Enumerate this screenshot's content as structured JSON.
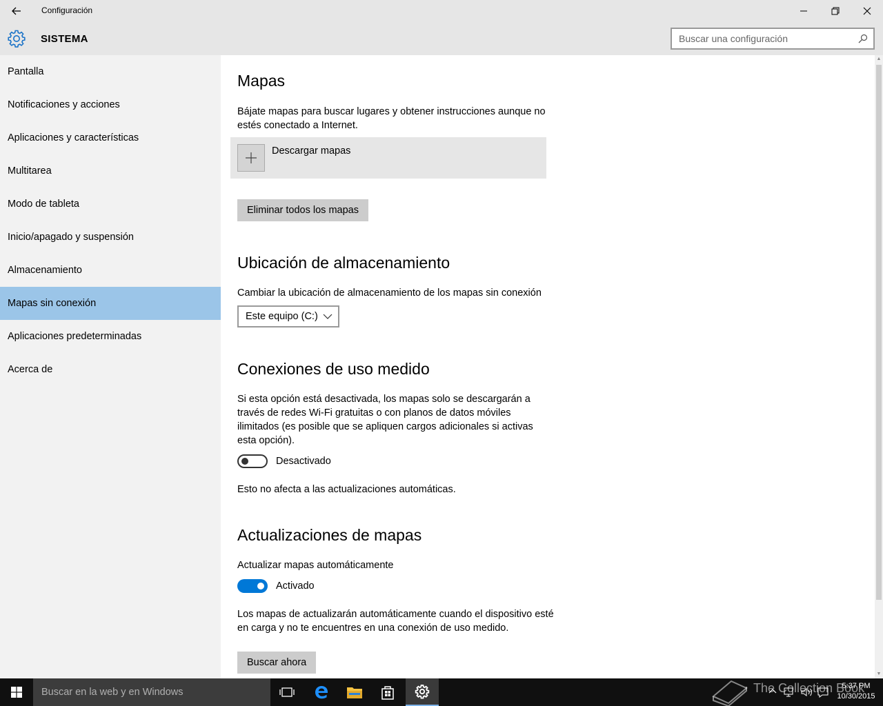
{
  "window": {
    "title": "Configuración",
    "section": "SISTEMA",
    "search_placeholder": "Buscar una configuración"
  },
  "sidebar": {
    "items": [
      {
        "label": "Pantalla"
      },
      {
        "label": "Notificaciones y acciones"
      },
      {
        "label": "Aplicaciones y características"
      },
      {
        "label": "Multitarea"
      },
      {
        "label": "Modo de tableta"
      },
      {
        "label": "Inicio/apagado y suspensión"
      },
      {
        "label": "Almacenamiento"
      },
      {
        "label": "Mapas sin conexión",
        "active": true
      },
      {
        "label": "Aplicaciones predeterminadas"
      },
      {
        "label": "Acerca de"
      }
    ]
  },
  "main": {
    "maps": {
      "title": "Mapas",
      "description": "Bájate mapas para buscar lugares y obtener instrucciones aunque no estés conectado a Internet.",
      "download_label": "Descargar mapas",
      "delete_all_label": "Eliminar todos los mapas"
    },
    "storage": {
      "title": "Ubicación de almacenamiento",
      "description": "Cambiar la ubicación de almacenamiento de los mapas sin conexión",
      "selected": "Este equipo (C:)"
    },
    "metered": {
      "title": "Conexiones de uso medido",
      "description": "Si esta opción está desactivada, los mapas solo se descargarán a través de redes Wi-Fi gratuitas o con planos de datos móviles ilimitados (es posible que se apliquen cargos adicionales si activas esta opción).",
      "toggle_label": "Desactivado",
      "toggle_on": false,
      "note": "Esto no afecta a las actualizaciones automáticas."
    },
    "updates": {
      "title": "Actualizaciones de mapas",
      "auto_label": "Actualizar mapas automáticamente",
      "toggle_label": "Activado",
      "toggle_on": true,
      "description": "Los mapas de actualizarán automáticamente cuando el dispositivo esté en carga y no te encuentres en una conexión de uso medido.",
      "check_now_label": "Buscar ahora"
    }
  },
  "taskbar": {
    "search_placeholder": "Buscar en la web y en Windows",
    "time": "5:37 PM",
    "date": "10/30/2015",
    "watermark": "The Collection Book"
  },
  "colors": {
    "accent": "#0078d7",
    "selected_nav": "#9bc5e8",
    "sidebar_bg": "#f2f2f2",
    "titlebar_bg": "#e6e6e6"
  }
}
